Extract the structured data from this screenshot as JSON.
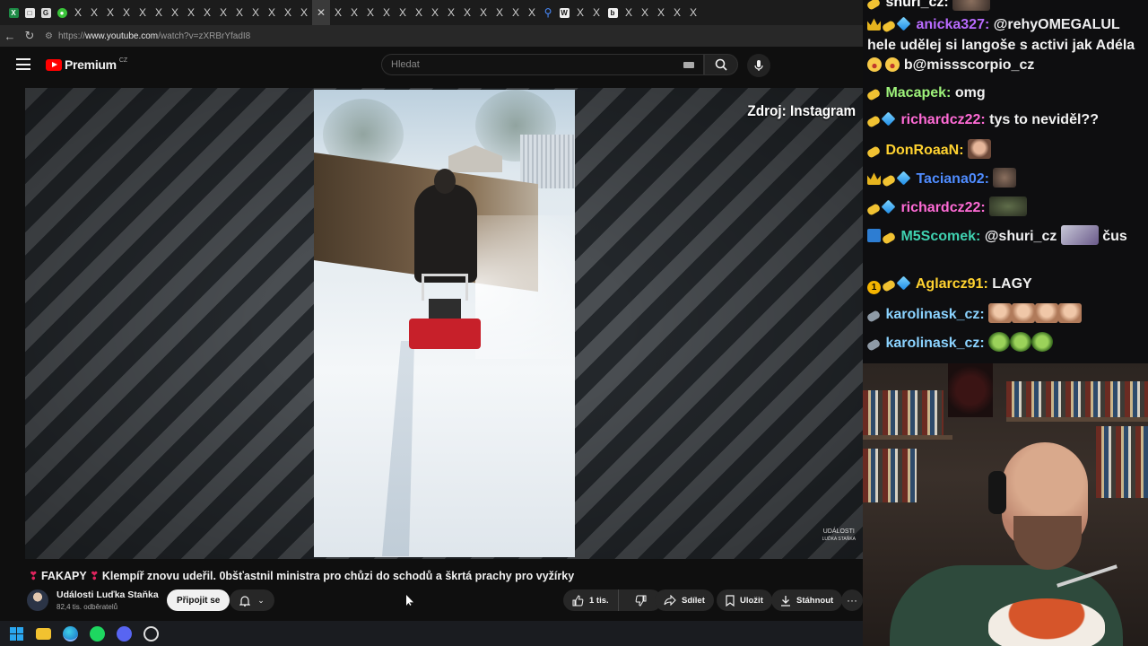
{
  "browser": {
    "url_prefix": "https://",
    "url_host": "www.youtube.com",
    "url_path": "/watch?v=zXRBrYfadI8",
    "tabs": [
      "X",
      "X",
      "X",
      "X",
      "X",
      "X",
      "X",
      "X",
      "X",
      "X",
      "X",
      "X",
      "X",
      "X",
      "X",
      "X",
      "X",
      "X",
      "X",
      "X",
      "X",
      "X",
      "X",
      "X",
      "X",
      "X",
      "X",
      "X",
      "X",
      "X",
      "X",
      "X",
      "X",
      "X",
      "X",
      "X",
      "X",
      "X",
      "X",
      "X"
    ]
  },
  "youtube": {
    "logo_text": "Premium",
    "logo_region": "CZ",
    "search_placeholder": "Hledat",
    "video": {
      "overlay_source": "Zdroj: Instagram",
      "watermark_line1": "UDÁLOSTI",
      "watermark_line2": "LUĎKA STAŇKA",
      "title_prefix": "FAKAPY",
      "title_rest": " Klempíř znovu udeřil. 0bšťastnil ministra pro chůzi do schodů a škrtá prachy pro vyžírky"
    },
    "channel": {
      "name": "Události Luďka Staňka",
      "subscribers": "82,4 tis. odběratelů",
      "join_label": "Připojit se"
    },
    "actions": {
      "like_count": "1 tis.",
      "share_label": "Sdílet",
      "save_label": "Uložit",
      "download_label": "Stáhnout",
      "more_label": "···"
    }
  },
  "chat": {
    "messages": [
      {
        "user": "shuri_cz",
        "color": "#ffffff",
        "text": ""
      },
      {
        "user": "anicka327",
        "color": "#b96bff",
        "text": "@rehyOMEGALUL",
        "cont": "hele udělej si langoše s activi jak Adéla",
        "cont2": "b@missscorpio_cz"
      },
      {
        "user": "Macapek",
        "color": "#9ef27a",
        "text": "omg"
      },
      {
        "user": "richardcz22",
        "color": "#ff6bd6",
        "text": "tys to neviděl??"
      },
      {
        "user": "DonRoaaN",
        "color": "#ffd230",
        "text": ""
      },
      {
        "user": "Taciana02",
        "color": "#4f8cff",
        "text": ""
      },
      {
        "user": "richardcz22",
        "color": "#ff6bd6",
        "text": ""
      },
      {
        "user": "M5Scomek",
        "color": "#3fd1b0",
        "text": "@shuri_cz",
        "after": "čus"
      },
      {
        "user": "Aglarcz91",
        "color": "#ffd230",
        "text": "LAGY"
      },
      {
        "user": "karolinask_cz",
        "color": "#8bd3ff",
        "text": ""
      },
      {
        "user": "karolinask_cz",
        "color": "#8bd3ff",
        "text": ""
      }
    ]
  }
}
